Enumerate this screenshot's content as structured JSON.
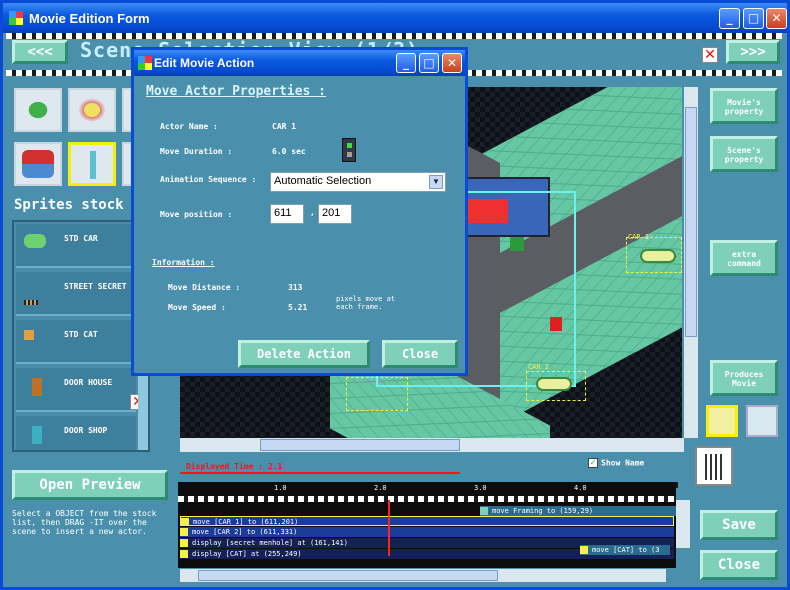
{
  "window": {
    "title": "Movie Edition Form"
  },
  "header": {
    "prev_label": "<<<",
    "next_label": ">>>",
    "title": "Scene Selection View (1/3)"
  },
  "sprites": {
    "title": "Sprites stock",
    "items": [
      {
        "label": "STD CAR",
        "icon": "car-icon"
      },
      {
        "label": "STREET SECRET",
        "icon": "manhole-icon"
      },
      {
        "label": "STD CAT",
        "icon": "cat-icon"
      },
      {
        "label": "DOOR HOUSE",
        "icon": "door-icon"
      },
      {
        "label": "DOOR SHOP",
        "icon": "shop-door-icon"
      }
    ]
  },
  "open_preview_label": "Open Preview",
  "hint_text": "Select a OBJECT from the stock list, then DRAG -IT over the scene to insert a new actor.",
  "scene": {
    "labels": [
      "CAR 1",
      "CAR 2"
    ]
  },
  "sidebar": {
    "movie_property": "Movie's property",
    "scene_property": "Scene's property",
    "extra_command": "extra command",
    "produces_movie": "Produces Movie"
  },
  "displayed_time": "Displayed Time : 2.1",
  "show_name": {
    "label": "Show Name",
    "checked": true
  },
  "timeline": {
    "ticks": [
      "1.0",
      "2.0",
      "3.0",
      "4.0"
    ],
    "cursor_time": 2.1,
    "rows": [
      "move Framing to (159,29)",
      "move [CAR 1] to (611,201)",
      "move [CAR 2] to (611,331)",
      "display [secret menhole] at (161,141)",
      "display [CAT] at (255,249)",
      "move [CAT] to (3"
    ]
  },
  "buttons": {
    "save": "Save",
    "close": "Close"
  },
  "dialog": {
    "title": "Edit Movie Action",
    "section": "Move Actor Properties :",
    "actor_name_label": "Actor Name :",
    "actor_name_value": "CAR 1",
    "move_duration_label": "Move Duration :",
    "move_duration_value": "6.0 sec",
    "animation_label": "Animation Sequence :",
    "animation_value": "Automatic Selection",
    "move_position_label": "Move position :",
    "pos_x": "611",
    "pos_sep": ",",
    "pos_y": "201",
    "info_title": "Information :",
    "move_distance_label": "Move Distance :",
    "move_distance_value": "313",
    "move_speed_label": "Move Speed :",
    "move_speed_value": "5.21",
    "speed_note": "pixels move at each frame.",
    "delete_label": "Delete Action",
    "close_label": "Close"
  }
}
